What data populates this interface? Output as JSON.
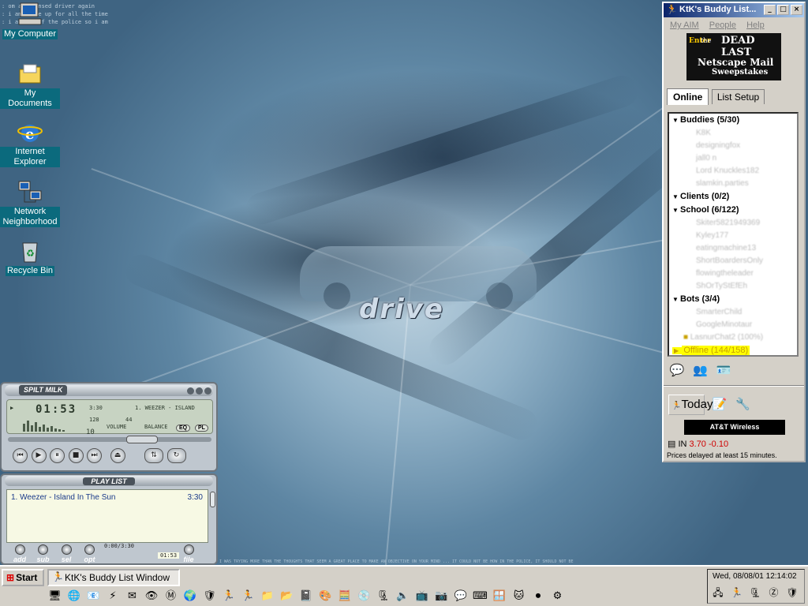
{
  "wallpaper": {
    "logo_text": "drive",
    "top_text_lines": [
      ": om a licensed driver again",
      ": i am awake up for all the time",
      ": i am ... of the police so i am"
    ],
    "footer_text": "I WAS TRYING MORE THAN THE THOUGHTS THAT SEEM A GREAT PLACE TO MAKE AN OBJECTIVE ON YOUR MIND ... IT COULD NOT BE HOW IN THE POLICE, IT SHOULD NOT BE"
  },
  "desktop_icons": [
    {
      "label": "My Computer",
      "icon": "computer-icon"
    },
    {
      "label": "My Documents",
      "icon": "folder-icon"
    },
    {
      "label": "Internet Explorer",
      "icon": "ie-icon"
    },
    {
      "label": "Network Neighborhood",
      "icon": "network-icon"
    },
    {
      "label": "Recycle Bin",
      "icon": "recycle-bin-icon"
    }
  ],
  "winamp": {
    "title": "SPILT MILK",
    "time": "01:53",
    "track_length": "3:30",
    "track_title": "1. WEEZER - ISLAND",
    "kbps": "128",
    "khz": "44",
    "volume_label": "VOLUME",
    "balance_label": "BALANCE",
    "eq_label": "EQ",
    "pl_label": "PL",
    "mono_stereo": "10"
  },
  "playlist": {
    "title": "PLAY LIST",
    "tracks": [
      {
        "title": "1. Weezer - Island In The Sun",
        "duration": "3:30"
      }
    ],
    "position": "0:00/3:30",
    "elapsed": "01:53",
    "buttons": [
      "add",
      "sub",
      "sel",
      "opt"
    ],
    "file_label": "file"
  },
  "aim": {
    "title": "KtK's Buddy List...",
    "menu": [
      "My AIM",
      "People",
      "Help"
    ],
    "ad": {
      "enter": "Enter",
      "line1": "the",
      "line2": "DEAD LAST",
      "line3": "Netscape Mail",
      "line4": "Sweepstakes"
    },
    "tabs": [
      "Online",
      "List Setup"
    ],
    "groups": [
      {
        "name": "Buddies (5/30)",
        "members": [
          "K8K",
          "designingfox",
          "jall0 n",
          "Lord Knuckles182",
          "slamkin.parties"
        ]
      },
      {
        "name": "Clients (0/2)",
        "members": []
      },
      {
        "name": "School (6/122)",
        "members": [
          "Skiter5821949369",
          "Kyley177",
          "eatingmachine13",
          "ShortBoardersOnly",
          "flowingtheleader",
          "ShOrTyStEfEh"
        ]
      },
      {
        "name": "Bots (3/4)",
        "members": [
          "SmarterChild",
          "GoogleMinotaur",
          "LasnurChat2 (100%)"
        ]
      }
    ],
    "offline_label": "Offline (144/158)",
    "today_label": "Today",
    "att_label": "AT&T Wireless",
    "stock": {
      "prefix": "IN",
      "value": "3.70",
      "change": "-0.10"
    },
    "delay_note": "Prices delayed at least 15 minutes."
  },
  "taskbar": {
    "start_label": "Start",
    "task_label": "KtK's Buddy List Window",
    "clock": "Wed, 08/08/01 12:14:02",
    "quick_launch_icons": [
      "desktop-icon",
      "ie-icon",
      "outlook-icon",
      "winamp-icon",
      "mail-icon",
      "eye-icon",
      "gmail-icon",
      "globe-icon",
      "spyware-icon",
      "aim-icon",
      "aim2-icon",
      "folders-icon",
      "ftp-icon",
      "notepad-icon",
      "paint-icon",
      "calc-icon",
      "cd-icon",
      "zip-icon",
      "volume-icon",
      "screen-icon",
      "photo-icon",
      "mirc-icon",
      "dos-icon",
      "xp-icon",
      "cat-icon",
      "disc-icon",
      "setup-icon"
    ],
    "tray_icons": [
      "network-tray-icon",
      "aim-tray-icon",
      "zip-tray-icon",
      "z-tray-icon",
      "av-tray-icon"
    ]
  }
}
